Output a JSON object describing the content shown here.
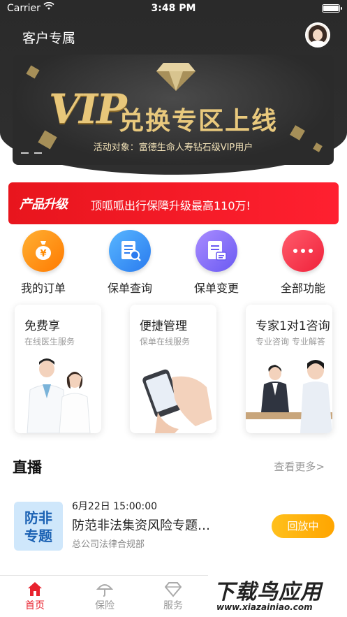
{
  "status_bar": {
    "carrier": "Carrier",
    "time": "3:48 PM"
  },
  "header": {
    "title": "客户专属"
  },
  "banner": {
    "headline_vip": "VIP",
    "headline_rest": "兑换专区上线",
    "description": "活动对象：富德生命人寿钻石级VIP用户",
    "slide_count": 2,
    "colors": {
      "gold": "#e8c77a",
      "background": "#2b2b2b"
    }
  },
  "promo": {
    "tag": "产品升级",
    "message": "顶呱呱出行保障升级最高110万!",
    "color": "#e8151d"
  },
  "quick_actions": [
    {
      "label": "我的订单",
      "icon": "money-bag-icon"
    },
    {
      "label": "保单查询",
      "icon": "document-search-icon"
    },
    {
      "label": "保单变更",
      "icon": "document-edit-icon"
    },
    {
      "label": "全部功能",
      "icon": "more-dots-icon"
    }
  ],
  "service_cards": [
    {
      "title": "免费享",
      "subtitle": "在线医生服务"
    },
    {
      "title": "便捷管理",
      "subtitle": "保单在线服务"
    },
    {
      "title": "专家1对1咨询",
      "subtitle": "专业咨询 专业解答"
    }
  ],
  "live": {
    "section_title": "直播",
    "more_label": "查看更多>",
    "item": {
      "thumb_line1": "防非",
      "thumb_line2": "专题",
      "date": "6月22日 15:00:00",
      "title": "防范非法集资风险专题…",
      "organizer": "总公司法律合规部",
      "action_label": "回放中"
    }
  },
  "tabbar": {
    "items": [
      {
        "label": "首页",
        "icon": "home-icon",
        "active": true
      },
      {
        "label": "保险",
        "icon": "umbrella-icon",
        "active": false
      },
      {
        "label": "服务",
        "icon": "diamond-icon",
        "active": false
      }
    ],
    "active_color": "#e8222e"
  },
  "watermark": {
    "brand": "下载鸟应用",
    "url": "www.xiazainiao.com"
  }
}
